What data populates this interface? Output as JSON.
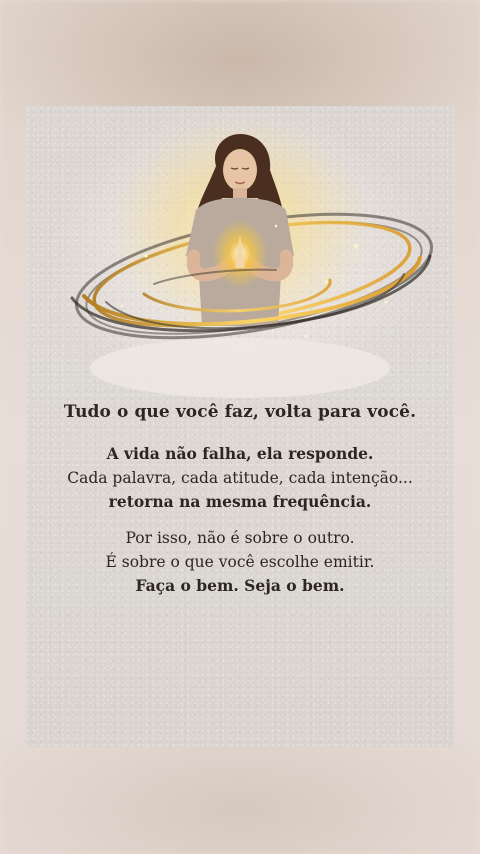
{
  "card": {
    "headline": "Tudo o que você faz, volta para você.",
    "stanza1": {
      "line1": "A vida não falha, ela responde.",
      "line2": "Cada palavra, cada atitude, cada intenção...",
      "line3": "retorna na mesma frequência."
    },
    "stanza2": {
      "line1": "Por isso, não é sobre o outro.",
      "line2": "É sobre o que você escolhe emitir.",
      "line3": "Faça o bem. Seja o bem."
    }
  },
  "colors": {
    "text": "#2b2622",
    "card_background": "#dcd6d2",
    "glow": "#f2c44a",
    "swirl_dark": "#3a342f"
  },
  "icons": {
    "ornament": "sparkle-icon"
  }
}
